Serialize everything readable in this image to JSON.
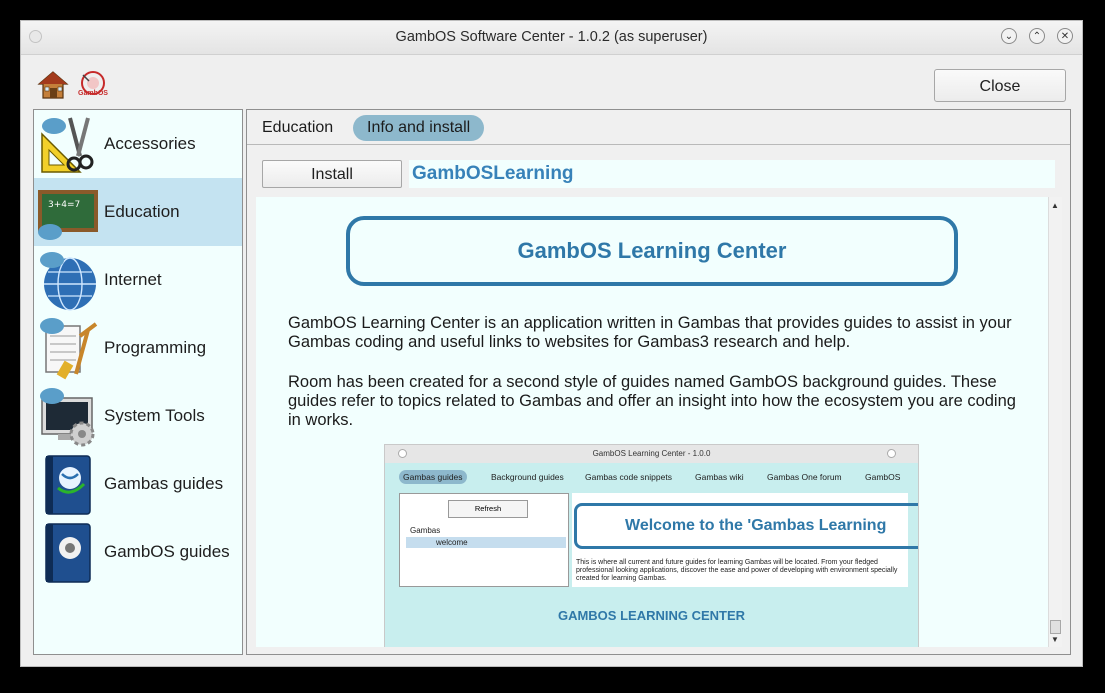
{
  "window": {
    "title": "GambOS Software Center - 1.0.2 (as superuser)",
    "controls": [
      "minimize",
      "maximize",
      "close"
    ]
  },
  "toolbar": {
    "home_icon": "home-icon",
    "gambos_logo_icon": "gambos-logo-icon",
    "gambos_logo_text": "GambOS",
    "close_label": "Close"
  },
  "sidebar": {
    "items": [
      {
        "label": "Accessories",
        "icon": "accessories-icon",
        "selected": false
      },
      {
        "label": "Education",
        "icon": "education-icon",
        "selected": true
      },
      {
        "label": "Internet",
        "icon": "internet-icon",
        "selected": false
      },
      {
        "label": "Programming",
        "icon": "programming-icon",
        "selected": false
      },
      {
        "label": "System Tools",
        "icon": "system-tools-icon",
        "selected": false
      },
      {
        "label": "Gambas guides",
        "icon": "gambas-guides-icon",
        "selected": false
      },
      {
        "label": "GambOS guides",
        "icon": "gambos-guides-icon",
        "selected": false
      }
    ],
    "education_chalk": "3+4=7"
  },
  "breadcrumb": {
    "items": [
      "Education",
      "Info and install"
    ],
    "active_index": 1
  },
  "package": {
    "install_label": "Install",
    "name": "GambOSLearning",
    "banner_title": "GambOS Learning Center",
    "paragraph1": "GambOS Learning Center is an application written in Gambas that provides guides to assist in your Gambas coding and useful links to websites for Gambas3 research and help.",
    "paragraph2": "Room has been created for a second style of guides named GambOS background guides. These guides refer to topics related to Gambas and offer an insight into how the ecosystem you are coding in works."
  },
  "screenshot": {
    "title": "GambOS Learning Center - 1.0.0",
    "tabs": [
      "Gambas guides",
      "Background guides",
      "Gambas code snippets",
      "Gambas wiki",
      "Gambas One forum",
      "GambOS"
    ],
    "refresh_label": "Refresh",
    "tree_root": "Gambas",
    "tree_child": "welcome",
    "welcome_banner": "Welcome to the 'Gambas Learning",
    "body_text": "This is where all current and future guides for learning Gambas will be located. From your fledged professional looking applications, discover the ease and power of developing with environment specially created for learning Gambas.",
    "caption": "GAMBOS LEARNING CENTER"
  },
  "colors": {
    "accent": "#2f78a8",
    "selected_row": "#c4e3f1",
    "active_crumb": "#8db8cc",
    "panel_bg": "#f2fffe"
  }
}
